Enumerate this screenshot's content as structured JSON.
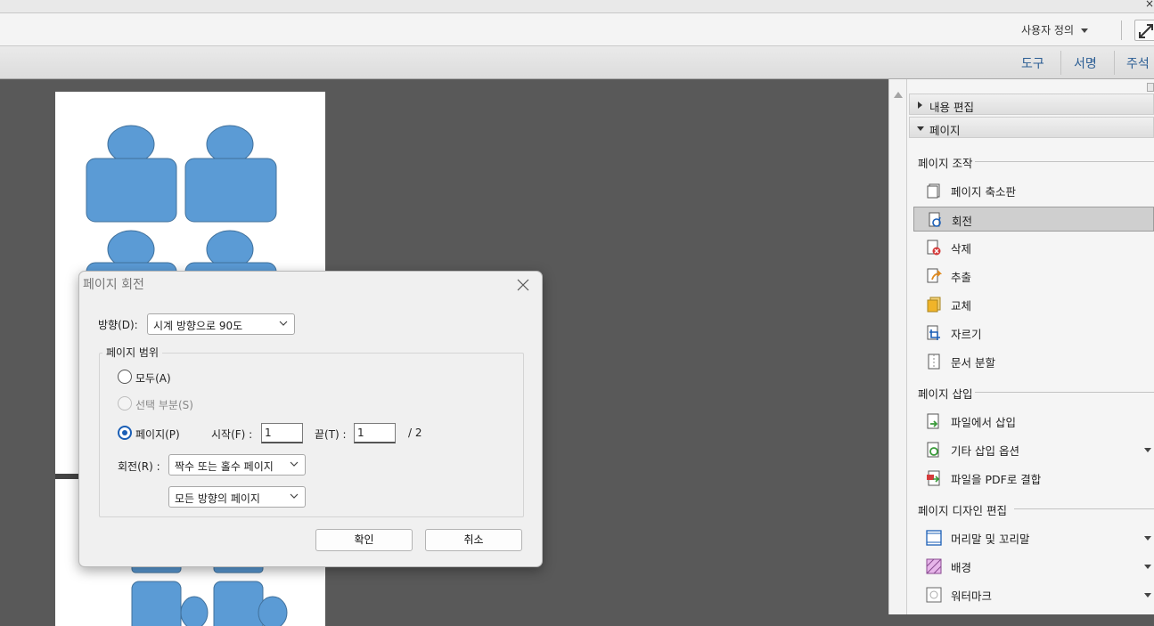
{
  "window": {
    "close_glyph": "×"
  },
  "menubar": {
    "custom_label": "사용자 정의",
    "expand_icon": "expand-arrows-icon"
  },
  "toolbar": {
    "tabs": [
      "도구",
      "서명",
      "주석"
    ]
  },
  "right_panel": {
    "sections": [
      {
        "label": "내용 편집",
        "expanded": false
      },
      {
        "label": "페이지",
        "expanded": true
      }
    ],
    "groups": {
      "page_manipulation": {
        "title": "페이지 조작",
        "items": [
          {
            "label": "페이지 축소판",
            "icon": "page-thumbnails-icon"
          },
          {
            "label": "회전",
            "icon": "rotate-icon",
            "selected": true
          },
          {
            "label": "삭제",
            "icon": "delete-page-icon"
          },
          {
            "label": "추출",
            "icon": "extract-page-icon"
          },
          {
            "label": "교체",
            "icon": "replace-page-icon"
          },
          {
            "label": "자르기",
            "icon": "crop-icon"
          },
          {
            "label": "문서 분할",
            "icon": "split-document-icon"
          }
        ]
      },
      "page_insert": {
        "title": "페이지 삽입",
        "items": [
          {
            "label": "파일에서 삽입",
            "icon": "insert-from-file-icon"
          },
          {
            "label": "기타 삽입 옵션",
            "icon": "more-insert-icon",
            "dropdown": true
          },
          {
            "label": "파일을 PDF로 결합",
            "icon": "combine-pdf-icon"
          }
        ]
      },
      "page_design": {
        "title": "페이지 디자인 편집",
        "items": [
          {
            "label": "머리말 및 꼬리말",
            "icon": "header-footer-icon",
            "dropdown": true
          },
          {
            "label": "배경",
            "icon": "background-icon",
            "dropdown": true
          },
          {
            "label": "워터마크",
            "icon": "watermark-icon",
            "dropdown": true
          }
        ]
      }
    }
  },
  "dialog": {
    "title": "페이지 회전",
    "direction_label": "방향(D):",
    "direction_value": "시계 방향으로 90도",
    "range_legend": "페이지 범위",
    "all_label": "모두(A)",
    "selection_label": "선택 부분(S)",
    "pages_label": "페이지(P)",
    "start_label": "시작(F) :",
    "start_value": "1",
    "end_label": "끝(T) :",
    "end_value": "1",
    "total": "/ 2",
    "rotate_label": "회전(R) :",
    "parity_value": "짝수 또는 홀수 페이지",
    "orientation_value": "모든 방향의 페이지",
    "ok_label": "확인",
    "cancel_label": "취소",
    "selected_range": "pages"
  },
  "colors": {
    "accent": "#1b5fb6",
    "tab_text": "#2c5e94",
    "shape_fill": "#5b9bd5",
    "shape_stroke": "#41719c",
    "doc_bg": "#595959"
  }
}
